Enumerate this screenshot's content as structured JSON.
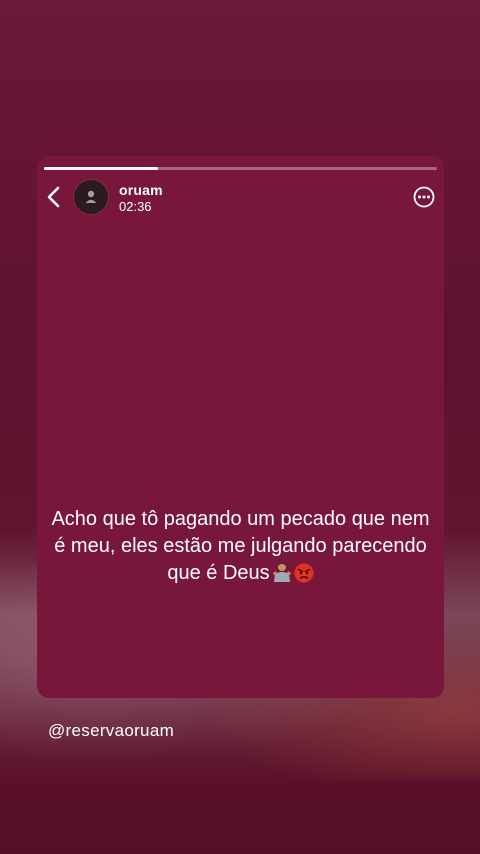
{
  "story": {
    "progress": 0.29,
    "user": {
      "name": "oruam",
      "time": "02:36"
    },
    "text": "Acho que tô pagando um pecado que nem é meu, eles estão me julgando parecendo que é Deus",
    "emojis": [
      "person-shrugging-emoji",
      "angry-face-emoji"
    ],
    "icons": {
      "back": "chevron-left-icon",
      "more": "more-options-icon",
      "avatar": "default-avatar-icon"
    }
  },
  "caption": {
    "handle": "@reservaoruam"
  },
  "colors": {
    "card": "#78163c",
    "background": "#5e1230"
  }
}
